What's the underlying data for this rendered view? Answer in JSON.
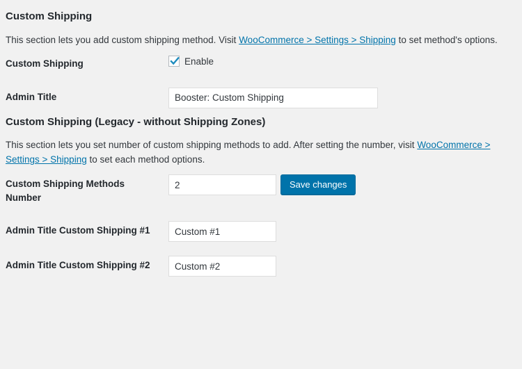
{
  "sections": [
    {
      "heading": "Custom Shipping",
      "description": {
        "before": "This section lets you add custom shipping method. Visit ",
        "link": "WooCommerce > Settings > Shipping",
        "after": " to set method's options."
      },
      "rows": [
        {
          "label": "Custom Shipping",
          "type": "checkbox",
          "checkbox_label": "Enable",
          "checked": true
        },
        {
          "label": "Admin Title",
          "type": "text",
          "value": "Booster: Custom Shipping",
          "width": "wide"
        }
      ]
    },
    {
      "heading": "Custom Shipping (Legacy - without Shipping Zones)",
      "description": {
        "before": "This section lets you set number of custom shipping methods to add. After setting the number, visit ",
        "link": "WooCommerce > Settings > Shipping",
        "after": " to set each method options."
      },
      "rows": [
        {
          "label": "Custom Shipping Methods Number",
          "type": "text-with-button",
          "value": "2",
          "width": "narrow",
          "button_label": "Save changes"
        },
        {
          "label": "Admin Title Custom Shipping #1",
          "type": "text",
          "value": "Custom #1",
          "width": "narrow"
        },
        {
          "label": "Admin Title Custom Shipping #2",
          "type": "text",
          "value": "Custom #2",
          "width": "narrow"
        }
      ]
    }
  ],
  "colors": {
    "background": "#f1f1f1",
    "link": "#0073aa",
    "button": "#0073aa",
    "text": "#23282d",
    "input_border": "#dddddd",
    "checkbox_check": "#1e8cbe"
  }
}
